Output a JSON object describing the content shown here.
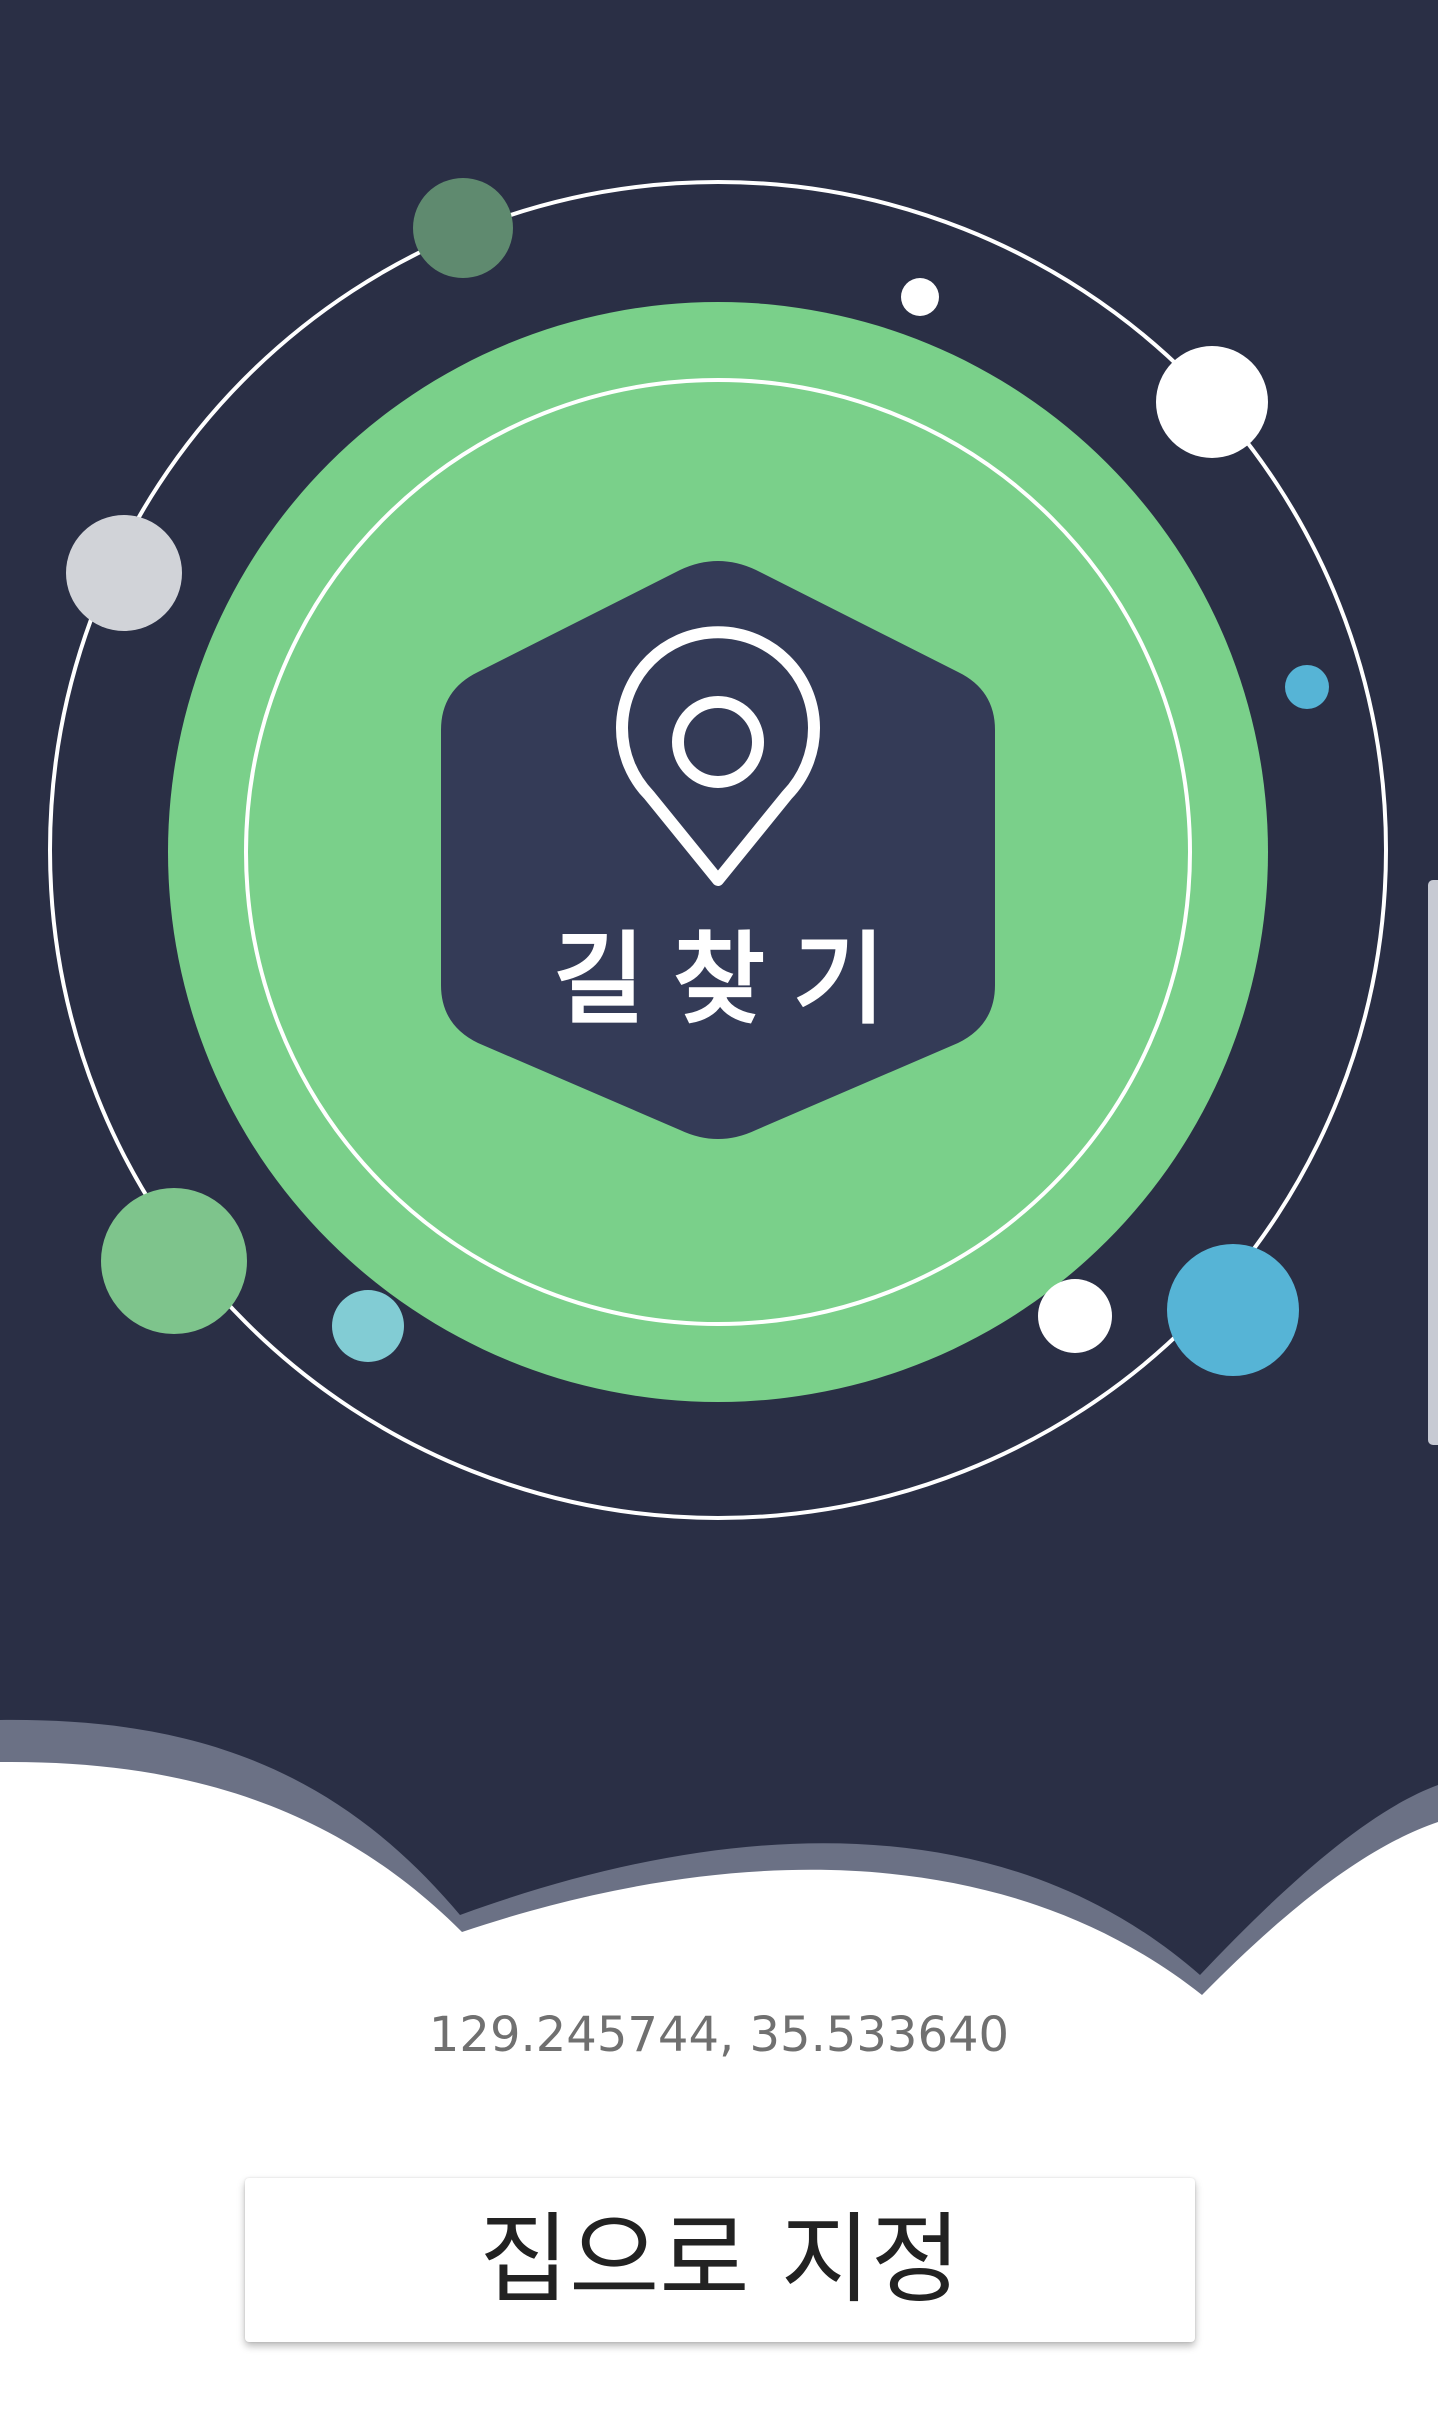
{
  "hero": {
    "logo_label": "길찾기",
    "icon": "location-pin-icon"
  },
  "location": {
    "coordinates_text": "129.245744, 35.533640"
  },
  "actions": {
    "set_home_label": "집으로 지정"
  },
  "colors": {
    "background_navy": "#2a2f45",
    "hexagon_navy": "#343b57",
    "accent_green": "#7ad08a",
    "accent_blue": "#56b4d6",
    "text_gray": "#707070"
  }
}
